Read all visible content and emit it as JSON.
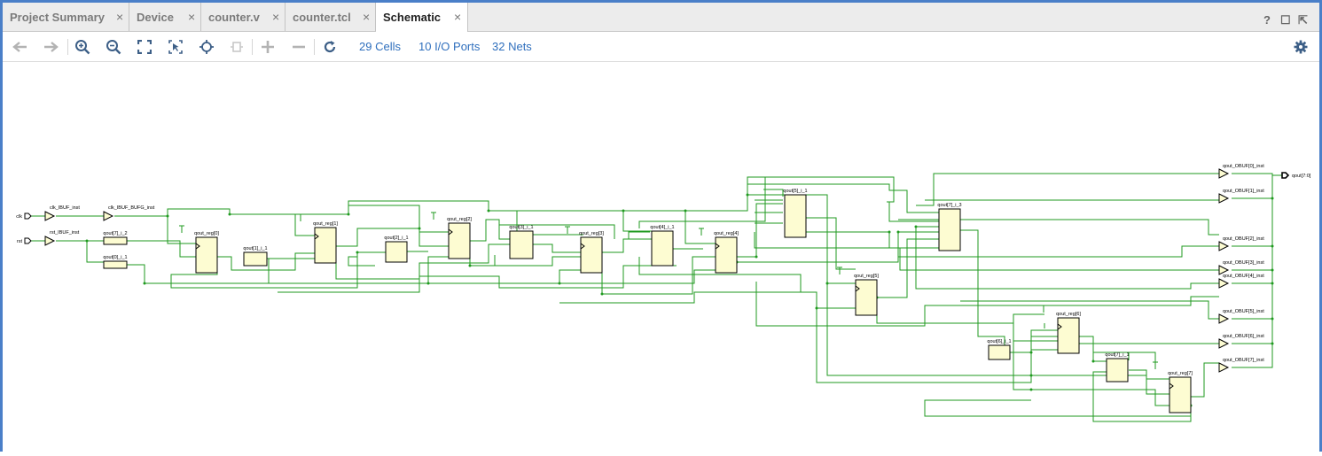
{
  "tabs": [
    {
      "label": "Project Summary",
      "close": "×"
    },
    {
      "label": "Device",
      "close": "×"
    },
    {
      "label": "counter.v",
      "close": "×"
    },
    {
      "label": "counter.tcl",
      "close": "×"
    },
    {
      "label": "Schematic",
      "close": "×",
      "active": true
    }
  ],
  "window_controls": {
    "help": "?",
    "restore": "☐",
    "float": "⇱"
  },
  "toolbar": {
    "icons": [
      "back-icon",
      "forward-icon",
      "zoom-in-icon",
      "zoom-out-icon",
      "fit-icon",
      "zoom-select-icon",
      "autofit-icon",
      "regenerate-icon",
      "expand-icon",
      "collapse-icon",
      "refresh-icon",
      "settings-icon"
    ]
  },
  "stats": {
    "cells": "29 Cells",
    "ports": "10 I/O Ports",
    "nets": "32 Nets"
  },
  "schematic": {
    "ports_in": [
      "clk",
      "rst"
    ],
    "port_out": "qout[7:0]",
    "buffers": {
      "clk_ibuf": "clk_IBUF_inst",
      "clk_bufg": "clk_IBUF_BUFG_inst",
      "rst_ibuf": "rst_IBUF_inst"
    },
    "cells": {
      "l7_2": "qout[7]_i_2",
      "l0_1": "qout[0]_i_1",
      "r0": "qout_reg[0]",
      "l1_1": "qout[1]_i_1",
      "r1": "qout_reg[1]",
      "l2_1": "qout[2]_i_1",
      "r2": "qout_reg[2]",
      "l3_1": "qout[3]_i_1",
      "r3": "qout_reg[3]",
      "l4_1": "qout[4]_i_1",
      "r4": "qout_reg[4]",
      "l5_1": "qout[5]_i_1",
      "r5": "qout_reg[5]",
      "l7_3": "qout[7]_i_3",
      "r6": "qout_reg[6]",
      "l6_1": "qout[6]_i_1",
      "l7_1": "qout[7]_i_1",
      "r7": "qout_reg[7]"
    },
    "obufs": [
      "qout_OBUF[0]_inst",
      "qout_OBUF[1]_inst",
      "qout_OBUF[2]_inst",
      "qout_OBUF[3]_inst",
      "qout_OBUF[4]_inst",
      "qout_OBUF[5]_inst",
      "qout_OBUF[6]_inst",
      "qout_OBUF[7]_inst"
    ],
    "colors": {
      "wire": "#1f9a1f",
      "cell_fill": "#fdfcd2",
      "cell_stroke": "#000000"
    }
  }
}
